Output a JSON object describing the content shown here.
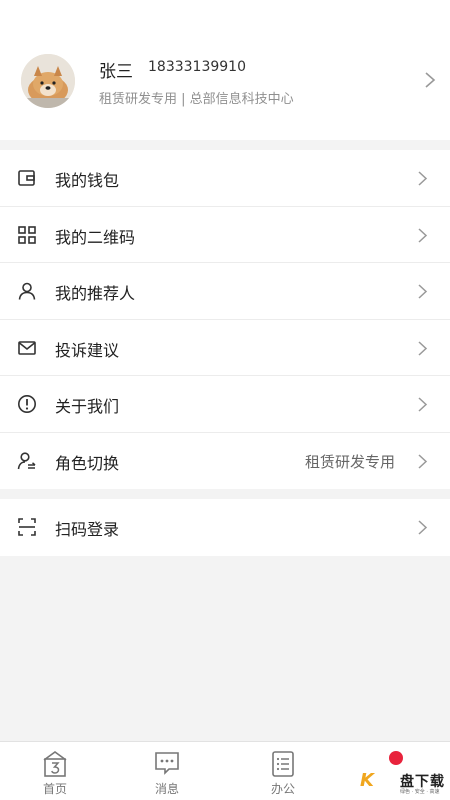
{
  "profile": {
    "name": "张三",
    "phone": "18333139910",
    "department": "租赁研发专用 | 总部信息科技中心"
  },
  "menu": {
    "group1": [
      {
        "icon": "wallet-icon",
        "label": "我的钱包",
        "value": ""
      },
      {
        "icon": "qr-grid-icon",
        "label": "我的二维码",
        "value": ""
      },
      {
        "icon": "person-icon",
        "label": "我的推荐人",
        "value": ""
      },
      {
        "icon": "mail-icon",
        "label": "投诉建议",
        "value": ""
      },
      {
        "icon": "info-icon",
        "label": "关于我们",
        "value": ""
      },
      {
        "icon": "switch-user-icon",
        "label": "角色切换",
        "value": "租赁研发专用"
      }
    ],
    "group2": [
      {
        "icon": "scan-icon",
        "label": "扫码登录",
        "value": ""
      }
    ]
  },
  "tabbar": {
    "tabs": [
      {
        "icon": "home-icon",
        "label": "首页"
      },
      {
        "icon": "message-icon",
        "label": "消息"
      },
      {
        "icon": "office-icon",
        "label": "办公"
      }
    ]
  },
  "watermark": {
    "brand_letter": "K",
    "text": "盘下载",
    "subtext": "绿色 · 安全 · 高速"
  },
  "colors": {
    "background": "#f3f3f3",
    "text": "#222222",
    "secondary_text": "#8f8f8f",
    "badge_red": "#e8233c"
  }
}
